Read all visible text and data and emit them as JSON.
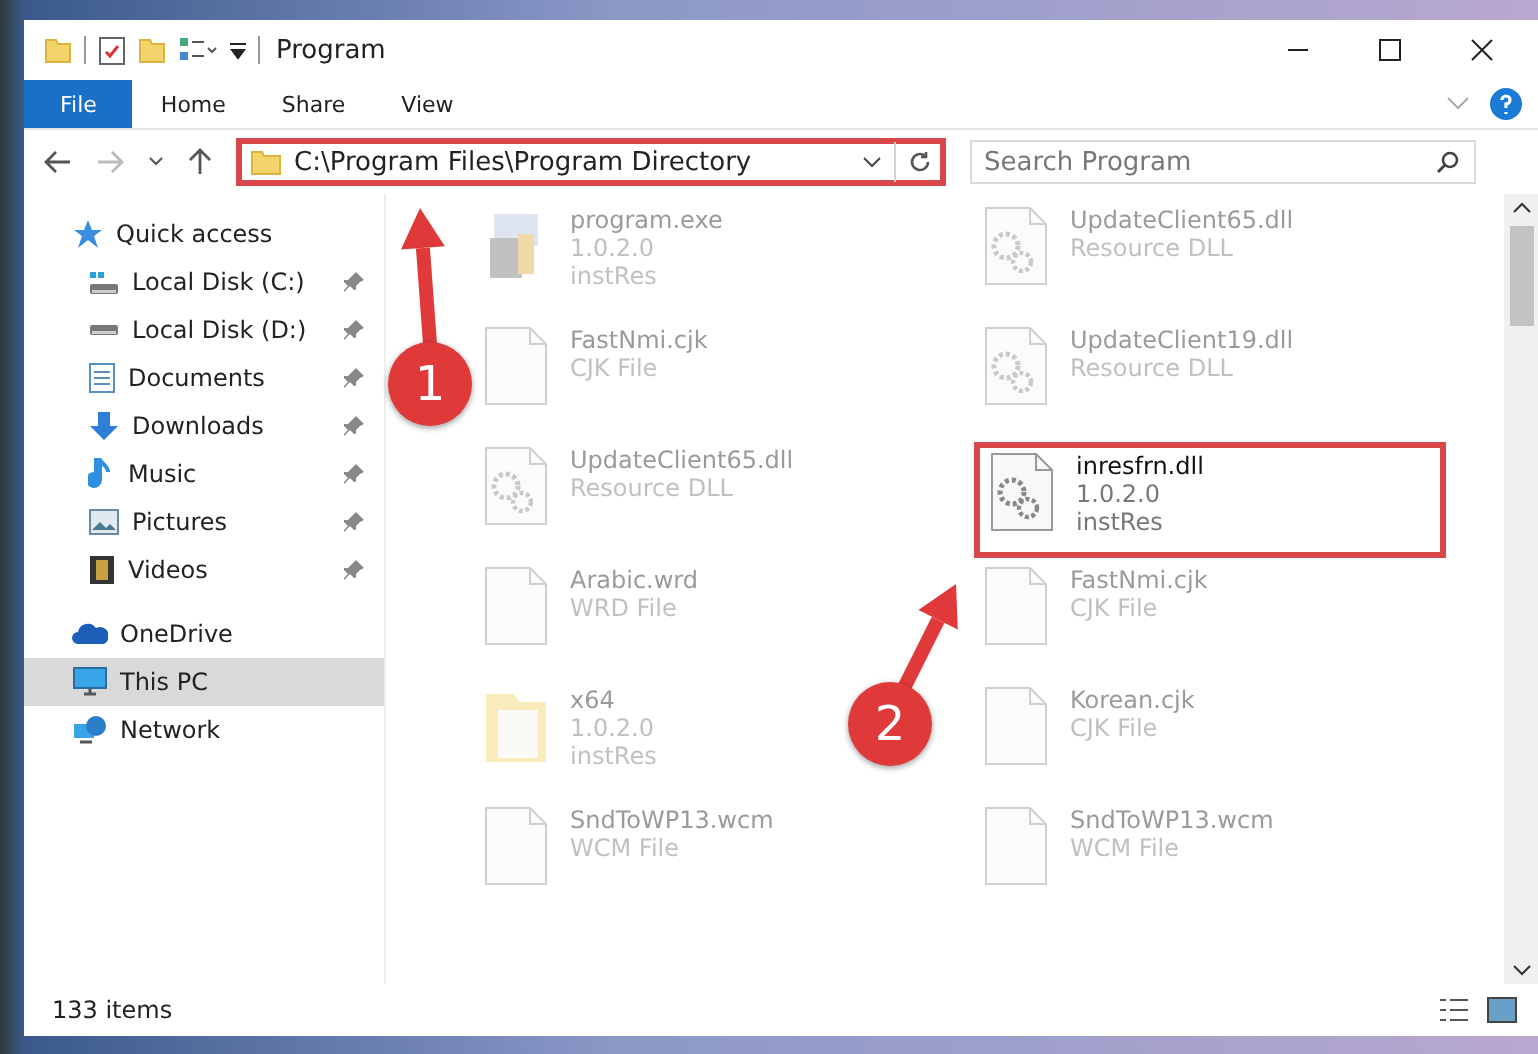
{
  "window": {
    "title": "Program"
  },
  "ribbon_tabs": [
    {
      "label": "File",
      "kind": "file"
    },
    {
      "label": "Home",
      "kind": "tab"
    },
    {
      "label": "Share",
      "kind": "tab"
    },
    {
      "label": "View",
      "kind": "tab"
    }
  ],
  "address_bar": {
    "path": "C:\\Program Files\\Program Directory",
    "highlighted": true
  },
  "search": {
    "placeholder": "Search Program"
  },
  "sidebar": {
    "items": [
      {
        "label": "Quick access",
        "kind": "quick",
        "selected": false,
        "children": [
          {
            "label": "Local Disk (C:)",
            "kind": "disk-c",
            "pinned": true,
            "selected": false
          },
          {
            "label": "Local Disk (D:)",
            "kind": "disk",
            "pinned": true,
            "selected": false
          },
          {
            "label": "Documents",
            "kind": "documents",
            "pinned": true,
            "selected": false
          },
          {
            "label": "Downloads",
            "kind": "downloads",
            "pinned": true,
            "selected": false
          },
          {
            "label": "Music",
            "kind": "music",
            "pinned": true,
            "selected": false
          },
          {
            "label": "Pictures",
            "kind": "pictures",
            "pinned": true,
            "selected": false
          },
          {
            "label": "Videos",
            "kind": "videos",
            "pinned": true,
            "selected": false
          }
        ]
      },
      {
        "label": "OneDrive",
        "kind": "cloud",
        "selected": false
      },
      {
        "label": "This PC",
        "kind": "pc",
        "selected": true
      },
      {
        "label": "Network",
        "kind": "network",
        "selected": false
      }
    ]
  },
  "files": [
    {
      "name": "program.exe",
      "details": [
        "1.0.2.0",
        "instRes"
      ],
      "kind": "exe",
      "faded": true,
      "highlighted": false
    },
    {
      "name": "UpdateClient65.dll",
      "details": [
        "Resource DLL"
      ],
      "kind": "dll",
      "faded": true,
      "highlighted": false
    },
    {
      "name": "FastNmi.cjk",
      "details": [
        "CJK File"
      ],
      "kind": "blank",
      "faded": true,
      "highlighted": false
    },
    {
      "name": "UpdateClient19.dll",
      "details": [
        "Resource DLL"
      ],
      "kind": "dll",
      "faded": true,
      "highlighted": false
    },
    {
      "name": "UpdateClient65.dll",
      "details": [
        "Resource DLL"
      ],
      "kind": "dll",
      "faded": true,
      "highlighted": false
    },
    {
      "name": "inresfrn.dll",
      "details": [
        "1.0.2.0",
        "instRes"
      ],
      "kind": "dll",
      "faded": false,
      "highlighted": true
    },
    {
      "name": "Arabic.wrd",
      "details": [
        "WRD File"
      ],
      "kind": "blank",
      "faded": true,
      "highlighted": false
    },
    {
      "name": "FastNmi.cjk",
      "details": [
        "CJK File"
      ],
      "kind": "blank",
      "faded": true,
      "highlighted": false
    },
    {
      "name": "x64",
      "details": [
        "1.0.2.0",
        "instRes"
      ],
      "kind": "folder",
      "faded": true,
      "highlighted": false
    },
    {
      "name": "Korean.cjk",
      "details": [
        "CJK File"
      ],
      "kind": "blank",
      "faded": true,
      "highlighted": false
    },
    {
      "name": "SndToWP13.wcm",
      "details": [
        "WCM File"
      ],
      "kind": "blank",
      "faded": true,
      "highlighted": false
    },
    {
      "name": "SndToWP13.wcm",
      "details": [
        "WCM File"
      ],
      "kind": "blank",
      "faded": true,
      "highlighted": false
    }
  ],
  "annotations": [
    {
      "label": "1"
    },
    {
      "label": "2"
    }
  ],
  "status_bar": {
    "item_count": "133 items"
  }
}
